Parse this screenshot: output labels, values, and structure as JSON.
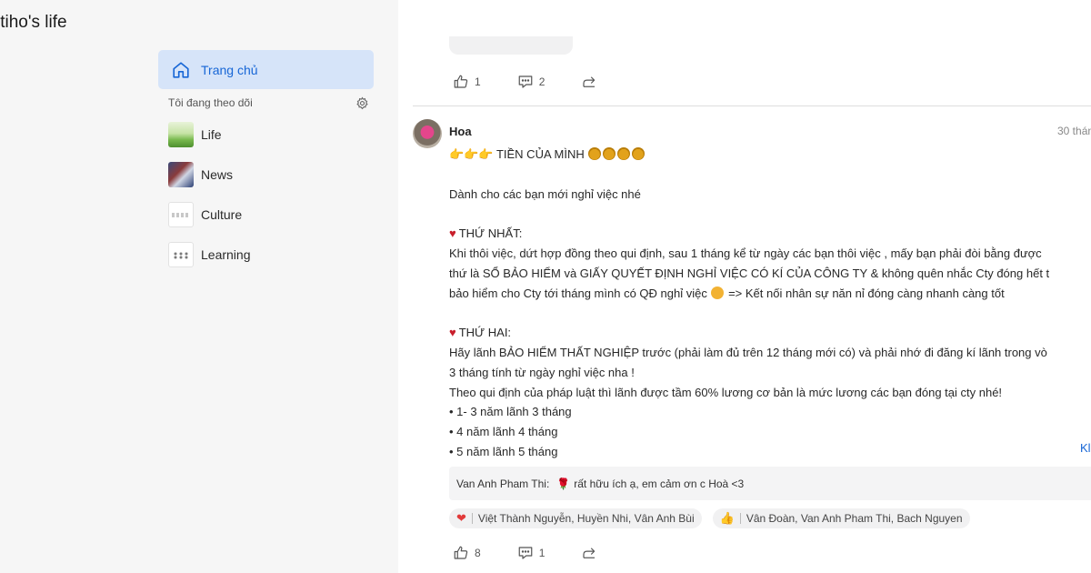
{
  "app_title": "itiho's life",
  "sidebar": {
    "home_label": "Trang chủ",
    "following_label": "Tôi đang theo dõi",
    "spaces": [
      {
        "label": "Life"
      },
      {
        "label": "News"
      },
      {
        "label": "Culture"
      },
      {
        "label": "Learning"
      }
    ]
  },
  "prev_post": {
    "likes": "1",
    "comments": "2"
  },
  "post": {
    "author": "Hoa",
    "time": "30 thán",
    "title_text": "TIỀN CỦA MÌNH",
    "intro": "Dành cho các bạn mới nghỉ việc nhé",
    "section1_heading": "THỨ NHẤT:",
    "section1_lines": [
      "Khi thôi việc, dứt hợp đồng theo qui định, sau 1 tháng kể từ ngày các bạn thôi việc , mấy bạn phải đòi bằng được",
      "thứ là SỔ BẢO HIỂM và GIẤY QUYẾT ĐỊNH NGHỈ VIỆC CÓ KÍ CỦA CÔNG TY & không quên nhắc Cty đóng hết t",
      "bảo hiểm cho Cty tới tháng mình có QĐ nghỉ việc",
      "=> Kết nối nhân sự năn nỉ đóng càng nhanh càng tốt"
    ],
    "section2_heading": "THỨ HAI:",
    "section2_lines": [
      "Hãy lãnh BẢO HIỂM THẤT NGHIỆP trước (phải làm đủ trên 12 tháng mới có) và phải nhớ đi đăng kí lãnh trong vò",
      "3 tháng tính từ ngày nghỉ việc nha !",
      "Theo qui định của pháp luật thì lãnh được tầm 60% lương cơ bản là mức lương các bạn đóng tại cty nhé!",
      "• 1- 3 năm lãnh 3 tháng",
      "• 4 năm lãnh 4 tháng",
      "• 5 năm lãnh 5 tháng"
    ],
    "more_link": "Kl",
    "comment": {
      "author": "Van Anh Pham Thi:",
      "text": "rất hữu ích ạ, em cảm ơn c Hoà <3"
    },
    "reactions": [
      {
        "icon": "heart",
        "names": "Việt Thành Nguyễn,  Huyền Nhi,  Vân Anh Bùi"
      },
      {
        "icon": "like",
        "names": "Vân Đoàn,  Van Anh Pham Thi,  Bach Nguyen"
      }
    ],
    "likes": "8",
    "comments": "1"
  }
}
